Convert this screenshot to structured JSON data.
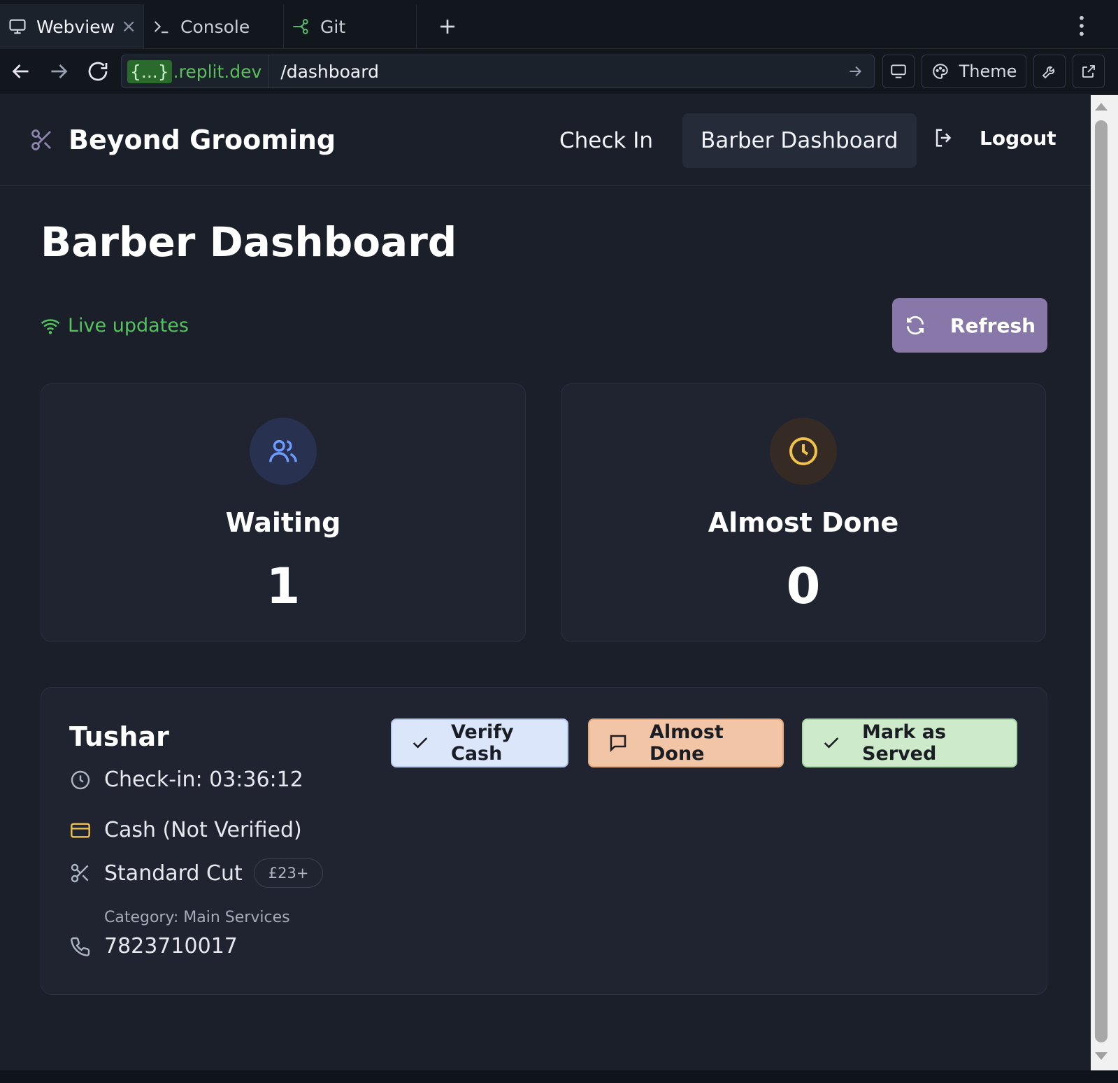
{
  "chrome": {
    "tabs": [
      {
        "label": "Webview",
        "icon": "monitor-icon",
        "active": true,
        "close": "×"
      },
      {
        "label": "Console",
        "icon": "terminal-icon"
      },
      {
        "label": "Git",
        "icon": "git-branch-icon"
      }
    ],
    "url": {
      "origin_badge": "{...}",
      "origin_domain": ".replit.dev",
      "path": "/dashboard"
    },
    "toolbar": {
      "theme_label": "Theme"
    }
  },
  "header": {
    "brand_name": "Beyond Grooming",
    "nav": {
      "check_in": "Check In",
      "barber_dashboard": "Barber Dashboard"
    },
    "logout_label": "Logout"
  },
  "dashboard": {
    "title": "Barber Dashboard",
    "live_label": "Live updates",
    "refresh_label": "Refresh"
  },
  "stats": {
    "waiting": {
      "label": "Waiting",
      "value": "1",
      "icon": "users-icon",
      "color": "#6e9bff"
    },
    "almost_done": {
      "label": "Almost Done",
      "value": "0",
      "icon": "clock-icon",
      "color": "#f1c24a"
    }
  },
  "customer": {
    "name": "Tushar",
    "check_in": "Check-in: 03:36:12",
    "payment": "Cash (Not Verified)",
    "service": "Standard Cut",
    "price": "£23+",
    "category": "Category: Main Services",
    "phone": "7823710017",
    "actions": {
      "verify_cash": "Verify Cash",
      "almost_done": "Almost Done",
      "mark_served": "Mark as Served"
    }
  },
  "colors": {
    "accent": "#8878a9",
    "live_green": "#56c25f",
    "verify_bg": "#dbe6fb",
    "almost_bg": "#f2c5a6",
    "served_bg": "#cdebcb"
  }
}
